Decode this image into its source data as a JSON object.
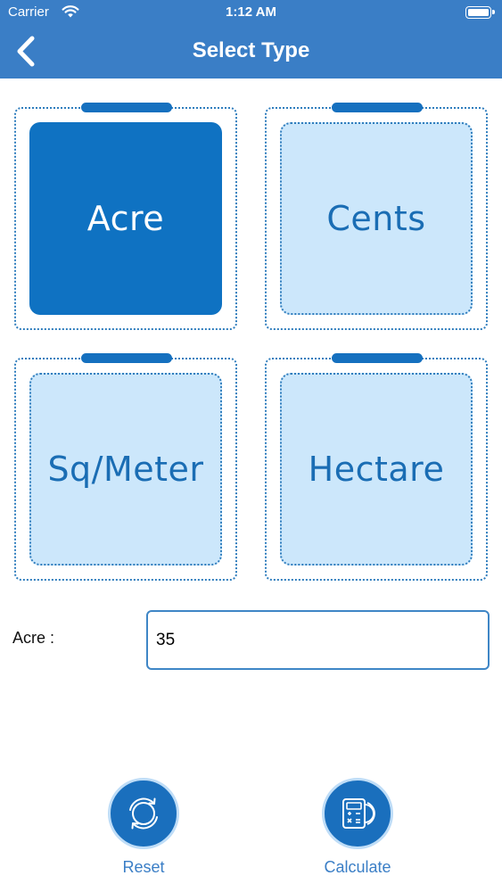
{
  "status_bar": {
    "carrier": "Carrier",
    "time": "1:12 AM"
  },
  "nav": {
    "title": "Select Type",
    "back_icon": "chevron-left-icon"
  },
  "types": [
    {
      "label": "Acre",
      "selected": true
    },
    {
      "label": "Cents",
      "selected": false
    },
    {
      "label": "Sq/Meter",
      "selected": false
    },
    {
      "label": "Hectare",
      "selected": false
    }
  ],
  "input": {
    "label": "Acre :",
    "value": "35"
  },
  "actions": {
    "reset": {
      "label": "Reset",
      "icon": "refresh-icon"
    },
    "calculate": {
      "label": "Calculate",
      "icon": "calculator-icon"
    }
  },
  "colors": {
    "header": "#3a7ec6",
    "selected_card": "#0f72c2",
    "card_fill": "#cce7fb",
    "accent": "#1a6fbd"
  }
}
